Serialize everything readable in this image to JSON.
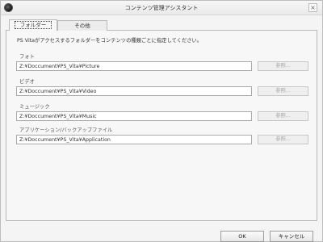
{
  "window": {
    "title": "コンテンツ管理アシスタント",
    "close_glyph": "×"
  },
  "tabs": [
    {
      "label": "フォルダー",
      "active": true
    },
    {
      "label": "その他",
      "active": false
    }
  ],
  "description": "PS Vitaがアクセスするフォルダーをコンテンツの種類ごとに指定してください。",
  "folders": [
    {
      "label": "フォト",
      "path": "Z:¥Doccument¥PS_Vita¥Picture",
      "browse_label": "参照..."
    },
    {
      "label": "ビデオ",
      "path": "Z:¥Doccument¥PS_Vita¥Video",
      "browse_label": "参照..."
    },
    {
      "label": "ミュージック",
      "path": "Z:¥Doccument¥PS_Vita¥Music",
      "browse_label": "参照..."
    },
    {
      "label": "アプリケーション/バックアップファイル",
      "path": "Z:¥Doccument¥PS_Vita¥Application",
      "browse_label": "参照..."
    }
  ],
  "buttons": {
    "ok": "OK",
    "cancel": "キャンセル"
  }
}
